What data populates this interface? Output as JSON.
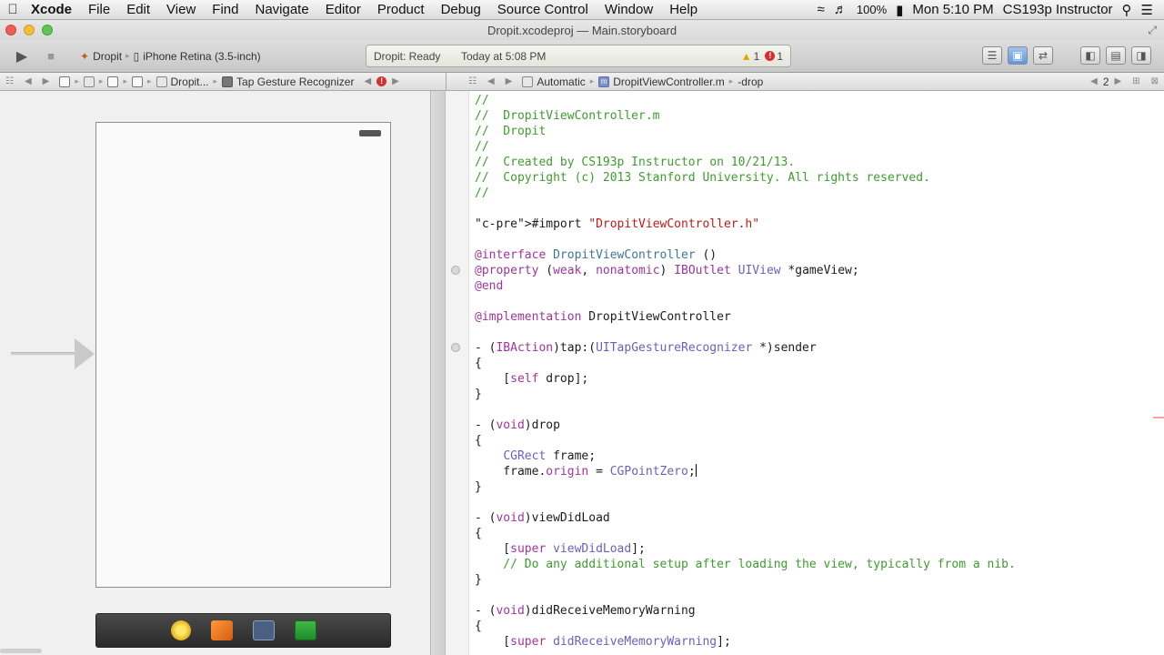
{
  "menubar": {
    "app": "Xcode",
    "items": [
      "File",
      "Edit",
      "View",
      "Find",
      "Navigate",
      "Editor",
      "Product",
      "Debug",
      "Source Control",
      "Window",
      "Help"
    ],
    "battery": "100%",
    "clock": "Mon 5:10 PM",
    "user": "CS193p Instructor"
  },
  "window": {
    "project_file": "Dropit.xcodeproj",
    "separator": "—",
    "open_file": "Main.storyboard"
  },
  "toolbar": {
    "scheme_target": "Dropit",
    "scheme_device": "iPhone Retina (3.5-inch)",
    "activity_status": "Dropit: Ready",
    "activity_time": "Today at 5:08 PM",
    "warnings_count": "1",
    "errors_count": "1"
  },
  "left_jumpbar": {
    "items": [
      "Dropit...",
      "Tap Gesture Recognizer"
    ]
  },
  "right_jumpbar": {
    "mode": "Automatic",
    "file": "DropitViewController.m",
    "symbol": "-drop",
    "counter": "2"
  },
  "code_lines": [
    "//",
    "//  DropitViewController.m",
    "//  Dropit",
    "//",
    "//  Created by CS193p Instructor on 10/21/13.",
    "//  Copyright (c) 2013 Stanford University. All rights reserved.",
    "//",
    "",
    "#import \"DropitViewController.h\"",
    "",
    "@interface DropitViewController ()",
    "@property (weak, nonatomic) IBOutlet UIView *gameView;",
    "@end",
    "",
    "@implementation DropitViewController",
    "",
    "- (IBAction)tap:(UITapGestureRecognizer *)sender",
    "{",
    "    [self drop];",
    "}",
    "",
    "- (void)drop",
    "{",
    "    CGRect frame;",
    "    frame.origin = CGPointZero;",
    "}",
    "",
    "- (void)viewDidLoad",
    "{",
    "    [super viewDidLoad];",
    "    // Do any additional setup after loading the view, typically from a nib.",
    "}",
    "",
    "- (void)didReceiveMemoryWarning",
    "{",
    "    [super didReceiveMemoryWarning];"
  ]
}
